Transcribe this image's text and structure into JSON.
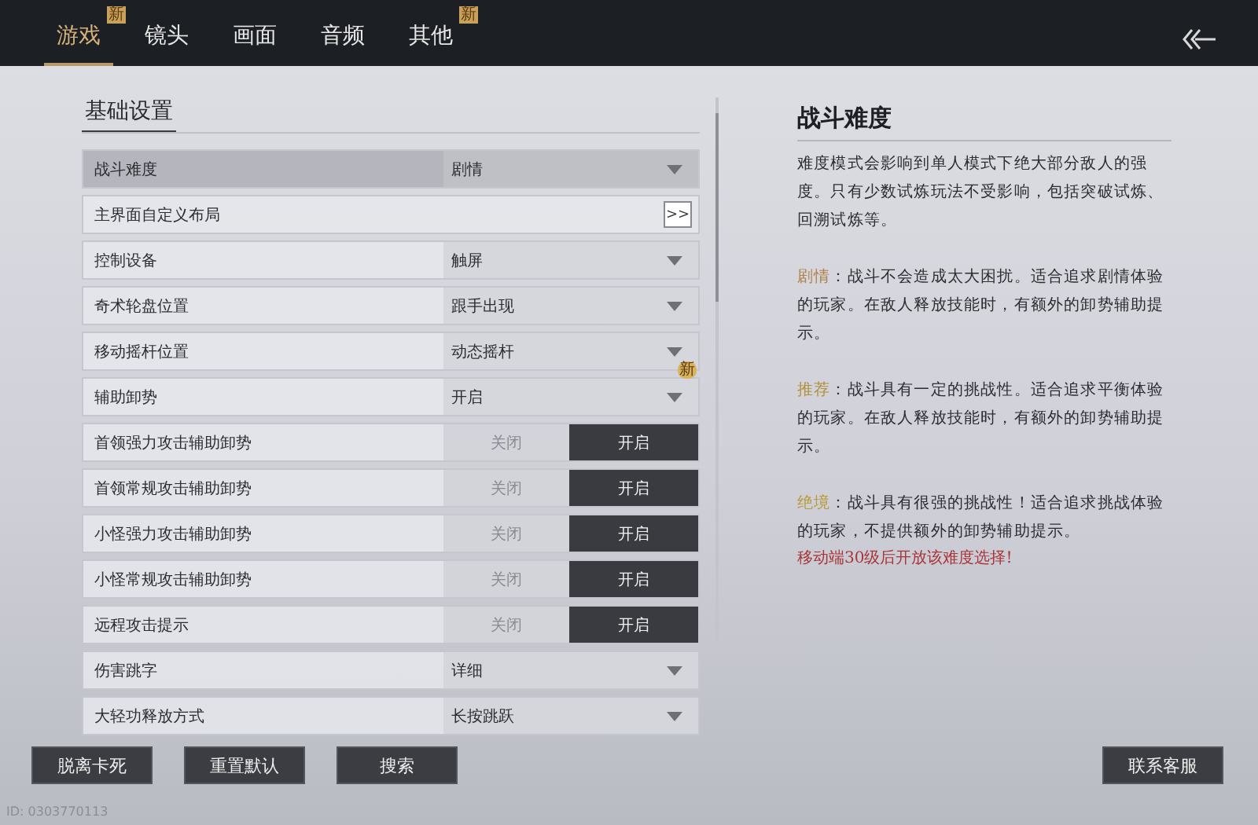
{
  "tabs": [
    {
      "label": "游戏",
      "selected": true,
      "badge": "新"
    },
    {
      "label": "镜头",
      "selected": false
    },
    {
      "label": "画面",
      "selected": false
    },
    {
      "label": "音频",
      "selected": false
    },
    {
      "label": "其他",
      "selected": false,
      "badge": "新"
    }
  ],
  "section_title": "基础设置",
  "rows": [
    {
      "kind": "dropdown",
      "label": "战斗难度",
      "value": "剧情",
      "selected": true
    },
    {
      "kind": "link",
      "label": "主界面自定义布局",
      "button": ">>",
      "selected": false
    },
    {
      "kind": "dropdown",
      "label": "控制设备",
      "value": "触屏",
      "selected": false
    },
    {
      "kind": "dropdown",
      "label": "奇术轮盘位置",
      "value": "跟手出现",
      "selected": false
    },
    {
      "kind": "dropdown",
      "label": "移动摇杆位置",
      "value": "动态摇杆",
      "selected": false
    },
    {
      "kind": "dropdown",
      "label": "辅助卸势",
      "value": "开启",
      "selected": false,
      "badge": "新"
    },
    {
      "kind": "toggle",
      "label": "首领强力攻击辅助卸势",
      "off_label": "关闭",
      "on_label": "开启",
      "on": true,
      "selected": false
    },
    {
      "kind": "toggle",
      "label": "首领常规攻击辅助卸势",
      "off_label": "关闭",
      "on_label": "开启",
      "on": true,
      "selected": false
    },
    {
      "kind": "toggle",
      "label": "小怪强力攻击辅助卸势",
      "off_label": "关闭",
      "on_label": "开启",
      "on": true,
      "selected": false
    },
    {
      "kind": "toggle",
      "label": "小怪常规攻击辅助卸势",
      "off_label": "关闭",
      "on_label": "开启",
      "on": true,
      "selected": false
    },
    {
      "kind": "toggle",
      "label": "远程攻击提示",
      "off_label": "关闭",
      "on_label": "开启",
      "on": true,
      "selected": false
    },
    {
      "kind": "dropdown",
      "label": "伤害跳字",
      "value": "详细",
      "selected": false
    },
    {
      "kind": "dropdown",
      "label": "大轻功释放方式",
      "value": "长按跳跃",
      "selected": false
    }
  ],
  "detail": {
    "title": "战斗难度",
    "paragraphs": [
      {
        "text": "难度模式会影响到单人模式下绝大部分敌人的强度。只有少数试炼玩法不受影响，包括突破试炼、回溯试炼等。"
      },
      {
        "label": "剧情",
        "color": "#b0814a",
        "text": "：战斗不会造成太大困扰。适合追求剧情体验的玩家。在敌人释放技能时，有额外的卸势辅助提示。"
      },
      {
        "label": "推荐",
        "color": "#b0903a",
        "text": "：战斗具有一定的挑战性。适合追求平衡体验的玩家。在敌人释放技能时，有额外的卸势辅助提示。"
      },
      {
        "label": "绝境",
        "color": "#b89a3a",
        "text": "：战斗具有很强的挑战性！适合追求挑战体验的玩家，不提供额外的卸势辅助提示。",
        "note": "移动端30级后开放该难度选择!"
      }
    ]
  },
  "buttons": [
    "脱离卡死",
    "重置默认",
    "搜索"
  ],
  "service_button": "联系客服",
  "footer_id": "ID: 0303770113"
}
